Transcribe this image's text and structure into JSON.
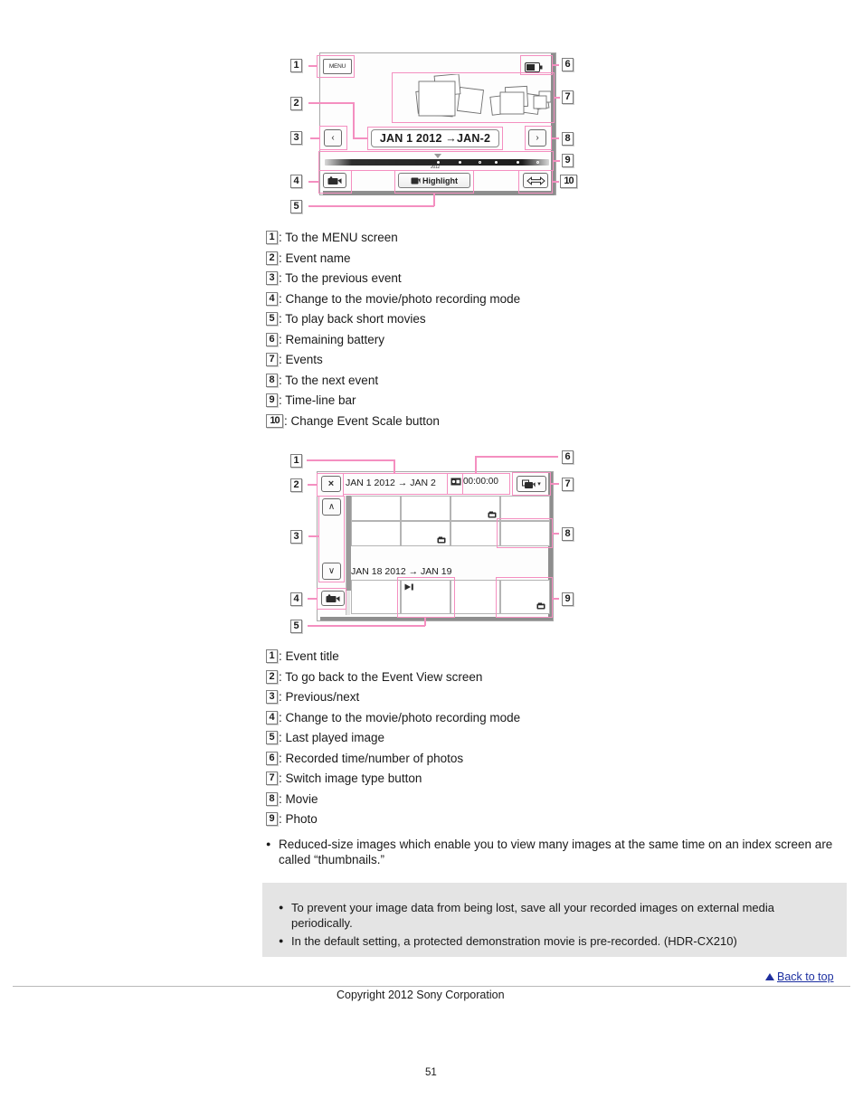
{
  "figure1": {
    "name": "event-view-screen",
    "menu_button_label": "MENU",
    "event_title": "JAN 1 2012 →JAN-2",
    "prev_arrow": "‹",
    "next_arrow": "›",
    "highlight_button_label": "Highlight",
    "timeline_year_label": "2012",
    "callouts": [
      "1",
      "2",
      "3",
      "4",
      "5",
      "6",
      "7",
      "8",
      "9",
      "10"
    ]
  },
  "list1": {
    "items": [
      {
        "num": "1",
        "text": ": To the MENU screen"
      },
      {
        "num": "2",
        "text": ": Event name"
      },
      {
        "num": "3",
        "text": ": To the previous event"
      },
      {
        "num": "4",
        "text": ": Change to the movie/photo recording mode"
      },
      {
        "num": "5",
        "text": ": To play back short movies"
      },
      {
        "num": "6",
        "text": ": Remaining battery"
      },
      {
        "num": "7",
        "text": ": Events"
      },
      {
        "num": "8",
        "text": ": To the next event"
      },
      {
        "num": "9",
        "text": ": Time-line bar"
      },
      {
        "num": "10",
        "text": ": Change Event Scale button"
      }
    ]
  },
  "figure2": {
    "name": "event-index-screen",
    "close_button_label": "×",
    "event_title": "JAN 1 2012 → JAN 2",
    "recorded_time": "00:00:00",
    "second_event_title": "JAN 18 2012 → JAN 19",
    "up_arrow": "∧",
    "down_arrow": "∨",
    "switch_dropdown_arrow": "▾",
    "callouts": [
      "1",
      "2",
      "3",
      "4",
      "5",
      "6",
      "7",
      "8",
      "9"
    ]
  },
  "list2": {
    "items": [
      {
        "num": "1",
        "text": ": Event title"
      },
      {
        "num": "2",
        "text": ": To go back to the Event View screen"
      },
      {
        "num": "3",
        "text": ": Previous/next"
      },
      {
        "num": "4",
        "text": ": Change to the movie/photo recording mode"
      },
      {
        "num": "5",
        "text": ": Last played image"
      },
      {
        "num": "6",
        "text": ": Recorded time/number of photos"
      },
      {
        "num": "7",
        "text": ": Switch image type button"
      },
      {
        "num": "8",
        "text": ": Movie"
      },
      {
        "num": "9",
        "text": ": Photo"
      }
    ],
    "bullet": {
      "marker": "●",
      "text": "Reduced-size images which enable you to view many images at the same time on an index screen are called “thumbnails.”"
    }
  },
  "notes": {
    "marker": "●",
    "items": [
      "To prevent your image data from being lost, save all your recorded images on external media periodically.",
      "In the default setting, a protected demonstration movie is pre-recorded. (HDR-CX210)"
    ]
  },
  "footer": {
    "back_to_top": "Back to top",
    "copyright": "Copyright 2012 Sony Corporation",
    "page_number": "51"
  },
  "colors": {
    "annotation": "#f48fc0",
    "link": "#1c2fa0",
    "note_bg": "#e4e4e4"
  }
}
